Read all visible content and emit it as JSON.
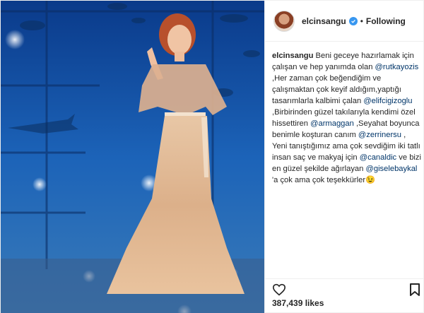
{
  "post": {
    "username": "elcinsangu",
    "follow_status": "Following",
    "separator": "•",
    "caption_parts": [
      {
        "type": "author",
        "text": "elcinsangu"
      },
      {
        "type": "text",
        "text": " Beni geceye hazırlamak için çalışan ve hep yanımda olan "
      },
      {
        "type": "mention",
        "text": "@rutkayozis"
      },
      {
        "type": "text",
        "text": " ,Her zaman çok beğendiğim ve çalışmaktan çok keyif aldığım,yaptığı tasarımlarla kalbimi çalan "
      },
      {
        "type": "mention",
        "text": "@elifcigizoglu"
      },
      {
        "type": "text",
        "text": " ,Birbirinden güzel takılarıyla kendimi özel hissettiren "
      },
      {
        "type": "mention",
        "text": "@armaggan"
      },
      {
        "type": "text",
        "text": " ,Seyahat boyunca benimle koşturan canım "
      },
      {
        "type": "mention",
        "text": "@zerrinersu"
      },
      {
        "type": "text",
        "text": " , Yeni tanıştığımız ama çok sevdiğim iki tatlı insan saç ve makyaj için "
      },
      {
        "type": "mention",
        "text": "@canaldic"
      },
      {
        "type": "text",
        "text": " ve bizi en güzel şekilde ağırlayan "
      },
      {
        "type": "mention",
        "text": "@giselebaykal"
      },
      {
        "type": "text",
        "text": " 'a çok ama çok teşekkürler😉"
      }
    ],
    "likes": "387,439 likes"
  },
  "icons": {
    "verified": "verified-badge-icon",
    "like": "heart-icon",
    "save": "bookmark-icon"
  },
  "colors": {
    "verified": "#3897f0",
    "mention": "#003569",
    "text": "#262626"
  }
}
